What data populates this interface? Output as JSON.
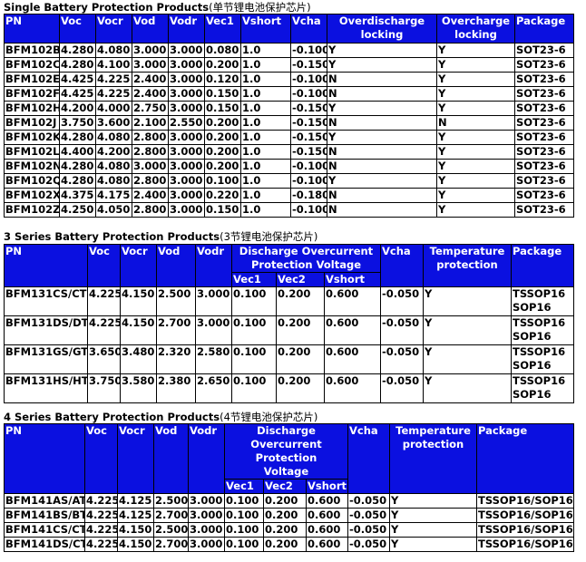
{
  "single": {
    "title": "Single Battery Protection Products",
    "title_cn": "(单节锂电池保护芯片)",
    "headers": [
      "PN",
      "Voc",
      "Vocr",
      "Vod",
      "Vodr",
      "Vec1",
      "Vshort",
      "Vcha",
      "Overdischarge locking",
      "Overcharge locking",
      "Package"
    ],
    "rows": [
      [
        "BFM102B",
        "4.280",
        "4.080",
        "3.000",
        "3.000",
        "0.080",
        "1.0",
        "-0.100",
        "Y",
        "Y",
        "SOT23-6"
      ],
      [
        "BFM102C",
        "4.280",
        "4.100",
        "3.000",
        "3.000",
        "0.200",
        "1.0",
        "-0.150",
        "Y",
        "Y",
        "SOT23-6"
      ],
      [
        "BFM102E",
        "4.425",
        "4.225",
        "2.400",
        "3.000",
        "0.120",
        "1.0",
        "-0.100",
        "N",
        "Y",
        "SOT23-6"
      ],
      [
        "BFM102F",
        "4.425",
        "4.225",
        "2.400",
        "3.000",
        "0.150",
        "1.0",
        "-0.100",
        "N",
        "Y",
        "SOT23-6"
      ],
      [
        "BFM102H",
        "4.200",
        "4.000",
        "2.750",
        "3.000",
        "0.150",
        "1.0",
        "-0.150",
        "Y",
        "Y",
        "SOT23-6"
      ],
      [
        "BFM102J",
        "3.750",
        "3.600",
        "2.100",
        "2.550",
        "0.200",
        "1.0",
        "-0.150",
        "N",
        "N",
        "SOT23-6"
      ],
      [
        "BFM102K",
        "4.280",
        "4.080",
        "2.800",
        "3.000",
        "0.200",
        "1.0",
        "-0.150",
        "Y",
        "Y",
        "SOT23-6"
      ],
      [
        "BFM102L",
        "4.400",
        "4.200",
        "2.800",
        "3.000",
        "0.200",
        "1.0",
        "-0.150",
        "N",
        "Y",
        "SOT23-6"
      ],
      [
        "BFM102N",
        "4.280",
        "4.080",
        "3.000",
        "3.000",
        "0.200",
        "1.0",
        "-0.100",
        "N",
        "Y",
        "SOT23-6"
      ],
      [
        "BFM102Q",
        "4.280",
        "4.080",
        "2.800",
        "3.000",
        "0.100",
        "1.0",
        "-0.100",
        "Y",
        "Y",
        "SOT23-6"
      ],
      [
        "BFM102X",
        "4.375",
        "4.175",
        "2.400",
        "3.000",
        "0.220",
        "1.0",
        "-0.180",
        "N",
        "Y",
        "SOT23-6"
      ],
      [
        "BFM102Z",
        "4.250",
        "4.050",
        "2.800",
        "3.000",
        "0.150",
        "1.0",
        "-0.100",
        "N",
        "Y",
        "SOT23-6"
      ]
    ]
  },
  "series3": {
    "title": "3 Series Battery Protection Products",
    "title_cn": "(3节锂电池保护芯片)",
    "headers": {
      "pn": "PN",
      "voc": "Voc",
      "vocr": "Vocr",
      "vod": "Vod",
      "vodr": "Vodr",
      "discharge": "Discharge Overcurrent Protection Voltage",
      "vec1": "Vec1",
      "vec2": "Vec2",
      "vshort": "Vshort",
      "vcha": "Vcha",
      "temp": "Temperature protection",
      "package": "Package"
    },
    "rows": [
      [
        "BFM131CS/CT",
        "4.225",
        "4.150",
        "2.500",
        "3.000",
        "0.100",
        "0.200",
        "0.600",
        "-0.050",
        "Y",
        "TSSOP16",
        "SOP16"
      ],
      [
        "BFM131DS/DT",
        "4.225",
        "4.150",
        "2.700",
        "3.000",
        "0.100",
        "0.200",
        "0.600",
        "-0.050",
        "Y",
        "TSSOP16",
        "SOP16"
      ],
      [
        "BFM131GS/GT",
        "3.650",
        "3.480",
        "2.320",
        "2.580",
        "0.100",
        "0.200",
        "0.600",
        "-0.050",
        "Y",
        "TSSOP16",
        "SOP16"
      ],
      [
        "BFM131HS/HT",
        "3.750",
        "3.580",
        "2.380",
        "2.650",
        "0.100",
        "0.200",
        "0.600",
        "-0.050",
        "Y",
        "TSSOP16",
        "SOP16"
      ]
    ]
  },
  "series4": {
    "title": "4 Series Battery Protection Products",
    "title_cn": "(4节锂电池保护芯片)",
    "headers": {
      "pn": "PN",
      "voc": "Voc",
      "vocr": "Vocr",
      "vod": "Vod",
      "vodr": "Vodr",
      "discharge": "Discharge Overcurrent Protection Voltage",
      "vec1": "Vec1",
      "vec2": "Vec2",
      "vshort": "Vshort",
      "vcha": "Vcha",
      "temp": "Temperature protection",
      "package": "Package"
    },
    "rows": [
      [
        "BFM141AS/AT",
        "4.225",
        "4.125",
        "2.500",
        "3.000",
        "0.100",
        "0.200",
        "0.600",
        "-0.050",
        "Y",
        "TSSOP16/SOP16"
      ],
      [
        "BFM141BS/BT",
        "4.225",
        "4.125",
        "2.700",
        "3.000",
        "0.100",
        "0.200",
        "0.600",
        "-0.050",
        "Y",
        "TSSOP16/SOP16"
      ],
      [
        "BFM141CS/CT",
        "4.225",
        "4.150",
        "2.500",
        "3.000",
        "0.100",
        "0.200",
        "0.600",
        "-0.050",
        "Y",
        "TSSOP16/SOP16"
      ],
      [
        "BFM141DS/CT",
        "4.225",
        "4.150",
        "2.700",
        "3.000",
        "0.100",
        "0.200",
        "0.600",
        "-0.050",
        "Y",
        "TSSOP16/SOP16"
      ]
    ]
  },
  "colors": {
    "header_bg": "#0b10e0",
    "header_text": "#ffffff"
  }
}
